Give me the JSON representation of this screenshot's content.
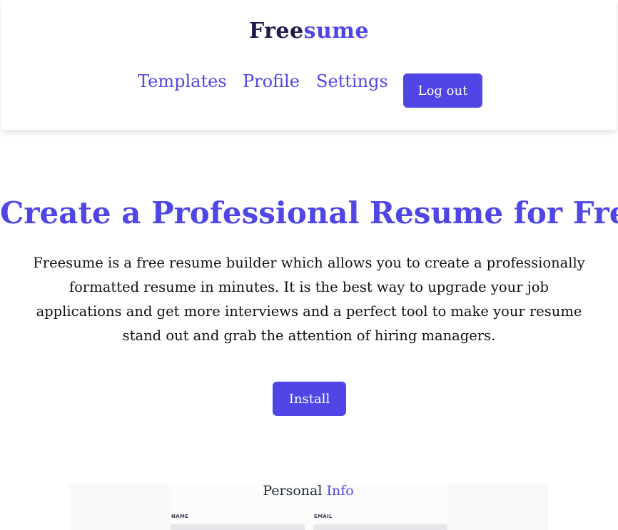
{
  "brand": {
    "part1": "Free",
    "part2": "sume"
  },
  "nav": {
    "templates": "Templates",
    "profile": "Profile",
    "settings": "Settings",
    "logout": "Log out"
  },
  "hero": {
    "title": "Create a Professional Resume for Free",
    "description": "Freesume is a free resume builder which allows you to create a professionally formatted resume in minutes. It is the best way to upgrade your job applications and get more interviews and a perfect tool to make your resume stand out and grab the attention of hiring managers.",
    "install": "Install"
  },
  "preview": {
    "title_part1": "Personal",
    "title_part2": "Info",
    "name_label": "NAME",
    "email_label": "EMAIL"
  },
  "colors": {
    "accent": "#4f46e5",
    "brand_dark": "#1e1b4b",
    "text": "#111111"
  }
}
